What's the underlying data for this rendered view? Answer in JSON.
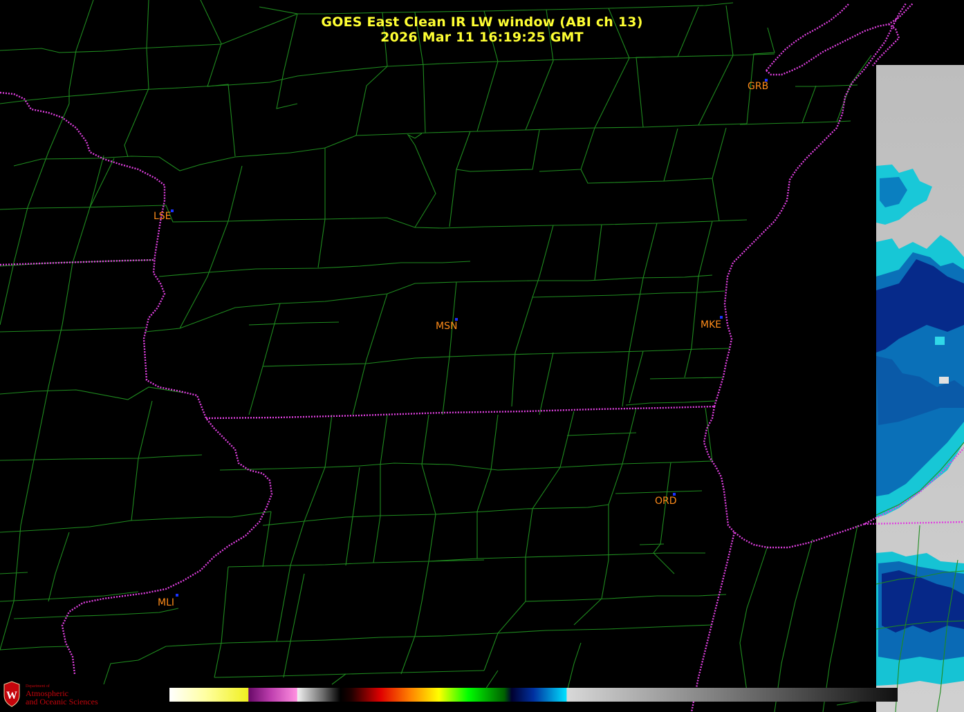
{
  "title": {
    "line1": "GOES East Clean IR LW window (ABI ch 13)",
    "line2": "2026 Mar 11  16:19:25 GMT"
  },
  "cities": [
    {
      "code": "GRB"
    },
    {
      "code": "LSE"
    },
    {
      "code": "MSN"
    },
    {
      "code": "MKE"
    },
    {
      "code": "ORD"
    },
    {
      "code": "MLI"
    }
  ],
  "colors": {
    "county_lines": "#1f8c1f",
    "state_borders": "#e040e0",
    "city_labels": "#ff8c1a",
    "city_markers": "#1a33ff",
    "title": "#ffff33"
  },
  "colorbar": {
    "segments": [
      "white-yellow",
      "purple-pink",
      "white-gray-black",
      "red-orange-yellow-green",
      "navy-blue-cyan",
      "gray-black"
    ]
  },
  "logo": {
    "line0": "Department of",
    "line1": "Atmospheric",
    "line2": "and Oceanic Sciences"
  }
}
